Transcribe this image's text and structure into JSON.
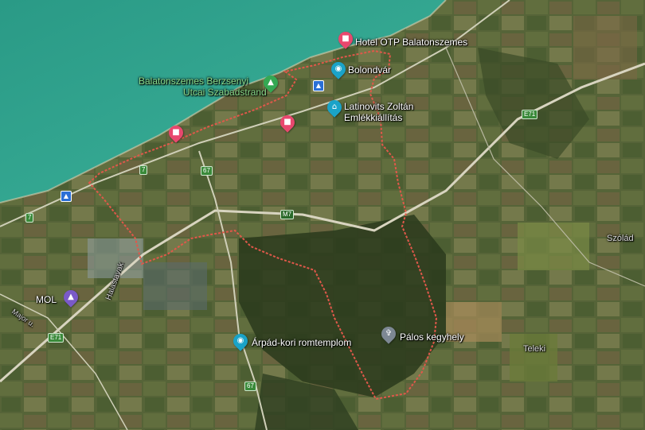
{
  "map": {
    "colors": {
      "water": "#2f9e8a",
      "boundary": "#e0584a",
      "hotel_pin": "#e8486e",
      "museum_pin": "#1aa3c8",
      "park_pin": "#34a853",
      "worship_pin": "#7d8893"
    },
    "places": {
      "hotel_otp": "Hotel OTP Balatonszemes",
      "bolondvar": "Bolondvár",
      "strand_line1": "Balatonszemes Berzsenyi",
      "strand_line2": "Utcai Szabadstrand",
      "latinovits_line1": "Latinovits Zoltán",
      "latinovits_line2": "Emlékkiállítás",
      "mol": "MOL",
      "arpad": "Árpád-kori romtemplom",
      "palos": "Pálos kegyhely",
      "szolad": "Szólád",
      "teleki": "Teleki",
      "halastavak": "Halastavak",
      "major": "Major u."
    },
    "roads": {
      "e71_ne": "E71",
      "e71_sw": "E71",
      "m7": "M7",
      "r7_a": "7",
      "r7_b": "7",
      "r67_n": "67",
      "r67_s": "67"
    },
    "icons": {
      "hotel": "bed-icon",
      "museum": "camera-icon",
      "park": "tree-icon",
      "worship": "church-icon",
      "fuel": "fuel-icon",
      "bus": "bus-stop-icon"
    }
  }
}
